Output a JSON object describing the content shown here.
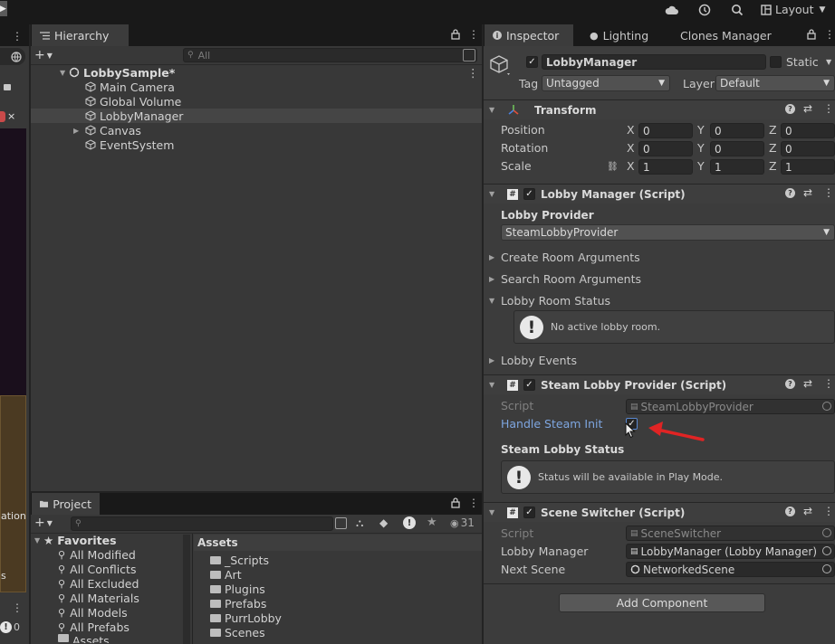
{
  "topbar": {
    "layout_label": "Layout"
  },
  "left_strip": {
    "text_fragment": "ation",
    "text_fragment2": "s",
    "count_badge": "0"
  },
  "hierarchy": {
    "tab_label": "Hierarchy",
    "search_placeholder": "All",
    "scene_name": "LobbySample*",
    "items": [
      {
        "label": "Main Camera"
      },
      {
        "label": "Global Volume"
      },
      {
        "label": "LobbyManager"
      },
      {
        "label": "Canvas"
      },
      {
        "label": "EventSystem"
      }
    ]
  },
  "project": {
    "tab_label": "Project",
    "hidden_count": "31",
    "favorites_label": "Favorites",
    "favorites": [
      "All Modified",
      "All Conflicts",
      "All Excluded",
      "All Materials",
      "All Models",
      "All Prefabs"
    ],
    "assets_root_short": "Assets",
    "assets_header": "Assets",
    "folders": [
      "_Scripts",
      "Art",
      "Plugins",
      "Prefabs",
      "PurrLobby",
      "Scenes"
    ]
  },
  "inspector": {
    "tabs": [
      "Inspector",
      "Lighting",
      "Clones Manager"
    ],
    "object_name": "LobbyManager",
    "static_label": "Static",
    "tag_label": "Tag",
    "tag_value": "Untagged",
    "layer_label": "Layer",
    "layer_value": "Default",
    "transform": {
      "title": "Transform",
      "rows": [
        {
          "label": "Position",
          "x": "0",
          "y": "0",
          "z": "0"
        },
        {
          "label": "Rotation",
          "x": "0",
          "y": "0",
          "z": "0"
        },
        {
          "label": "Scale",
          "x": "1",
          "y": "1",
          "z": "1"
        }
      ],
      "axis_x": "X",
      "axis_y": "Y",
      "axis_z": "Z"
    },
    "lobby_manager": {
      "title": "Lobby Manager (Script)",
      "provider_label": "Lobby Provider",
      "provider_value": "SteamLobbyProvider",
      "foldouts": [
        "Create Room Arguments",
        "Search Room Arguments",
        "Lobby Room Status"
      ],
      "status_message": "No active lobby room.",
      "events_label": "Lobby Events"
    },
    "steam_provider": {
      "title": "Steam Lobby Provider (Script)",
      "script_label": "Script",
      "script_value": "SteamLobbyProvider",
      "handle_init_label": "Handle Steam Init",
      "handle_init_checked": true,
      "status_label": "Steam Lobby Status",
      "status_message": "Status will be available in Play Mode."
    },
    "scene_switcher": {
      "title": "Scene Switcher (Script)",
      "script_label": "Script",
      "script_value": "SceneSwitcher",
      "lobby_manager_label": "Lobby Manager",
      "lobby_manager_value": "LobbyManager (Lobby Manager)",
      "next_scene_label": "Next Scene",
      "next_scene_value": "NetworkedScene"
    },
    "add_component": "Add Component"
  },
  "annotation": {
    "arrow_color": "#e02424"
  }
}
